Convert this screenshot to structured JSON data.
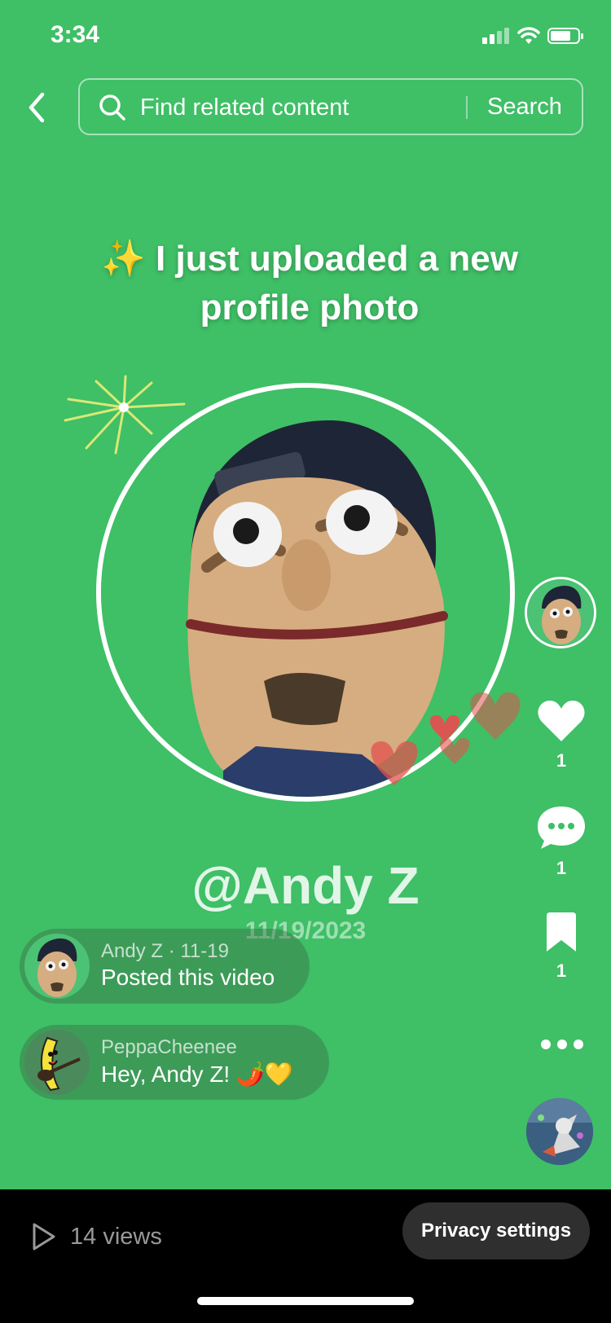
{
  "status_bar": {
    "time": "3:34"
  },
  "search": {
    "placeholder": "Find related content",
    "button_label": "Search"
  },
  "caption": {
    "emoji": "✨",
    "line1": "I just uploaded a new",
    "line2": "profile photo"
  },
  "profile": {
    "username": "@Andy Z",
    "date": "11/19/2023"
  },
  "actions": {
    "likes": "1",
    "comments": "1",
    "saves": "1"
  },
  "comments": [
    {
      "meta": "Andy Z · 11-19",
      "text": "Posted this video"
    },
    {
      "meta": "PeppaCheenee",
      "text": "Hey, Andy Z! 🌶️💛"
    }
  ],
  "footer": {
    "views": "14 views",
    "privacy_label": "Privacy settings"
  },
  "colors": {
    "background": "#3fbf66",
    "heart": "#e2514f"
  }
}
